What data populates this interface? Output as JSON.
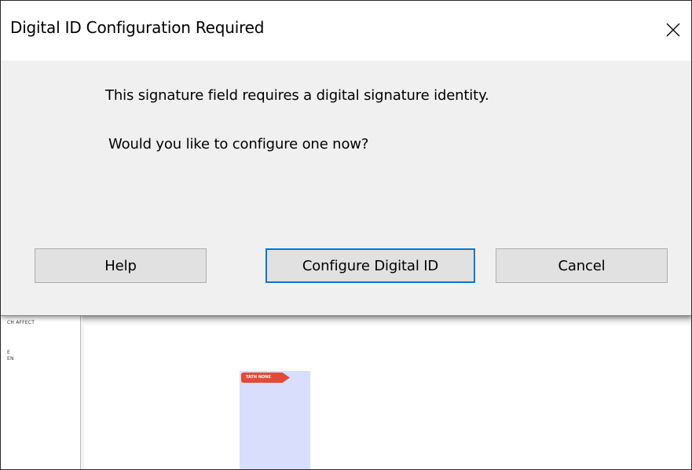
{
  "dialog": {
    "title": "Digital ID Configuration Required",
    "message_line1": "This signature field requires a digital signature identity.",
    "message_line2": "Would you like to configure one now?",
    "buttons": {
      "help": "Help",
      "configure": "Configure Digital ID",
      "cancel": "Cancel"
    },
    "default_button_color": "#0078d7",
    "background_color": "#f0f0f0"
  },
  "background_document": {
    "left_panel_snippets": [
      "CH AFFECT",
      "E",
      "EN"
    ],
    "tag_label": "TATH NONE",
    "highlight_color": "#d8defb",
    "tag_color": "#e14b37"
  },
  "icons": {
    "close": "close-x-icon"
  }
}
